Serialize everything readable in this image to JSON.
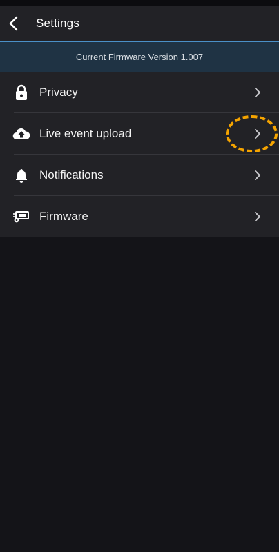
{
  "header": {
    "title": "Settings",
    "back_icon": "chevron-left-icon"
  },
  "banner": {
    "text": "Current Firmware Version 1.007"
  },
  "menu": {
    "items": [
      {
        "label": "Privacy",
        "icon": "lock-icon"
      },
      {
        "label": "Live event upload",
        "icon": "cloud-upload-icon"
      },
      {
        "label": "Notifications",
        "icon": "bell-icon"
      },
      {
        "label": "Firmware",
        "icon": "firmware-chip-icon"
      }
    ]
  },
  "colors": {
    "background": "#141418",
    "header": "#222226",
    "banner": "#1f3344",
    "banner_border": "#4a90c8",
    "highlight": "#f5a400"
  }
}
